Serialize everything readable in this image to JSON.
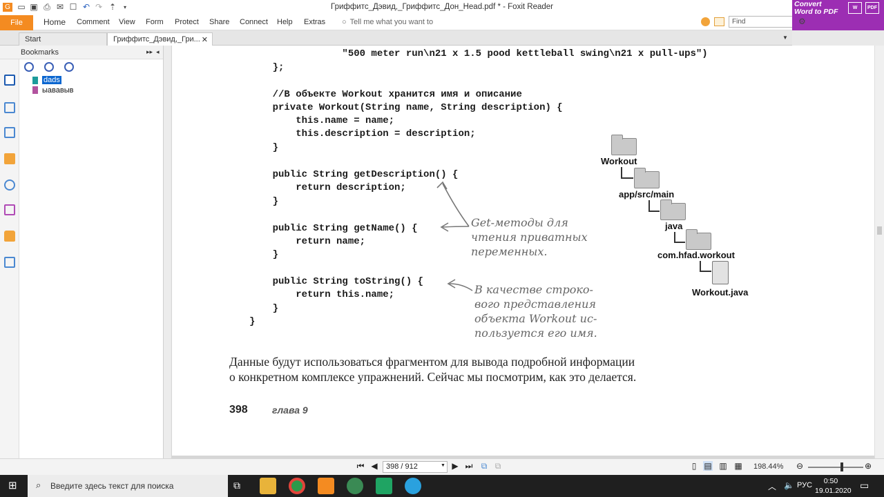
{
  "window": {
    "title": "Гриффитс_Дэвид,_Гриффитс_Дон_Head.pdf * - Foxit Reader"
  },
  "ribbon": {
    "file": "File",
    "menus": [
      "Home",
      "Comment",
      "View",
      "Form",
      "Protect",
      "Share",
      "Connect",
      "Help",
      "Extras"
    ],
    "tell_me": "Tell me what you want to",
    "find_placeholder": "Find",
    "convert_line1": "Convert",
    "convert_line2": "Word to PDF"
  },
  "tabs": [
    {
      "label": "Start"
    },
    {
      "label": "Гриффитс_Дэвид,_Гри..."
    }
  ],
  "bookmarks": {
    "header": "Bookmarks",
    "items": [
      "dads",
      "ыававыв"
    ]
  },
  "document": {
    "code_lines": [
      "                \"500 meter run\\n21 x 1.5 pood kettleball swing\\n21 x pull-ups\")",
      "    };",
      "",
      "    //В объекте Workout хранится имя и описание",
      "    private Workout(String name, String description) {",
      "        this.name = name;",
      "        this.description = description;",
      "    }",
      "",
      "    public String getDescription() {",
      "        return description;",
      "    }",
      "",
      "    public String getName() {",
      "        return name;",
      "    }",
      "",
      "    public String toString() {",
      "        return this.name;",
      "    }",
      "}"
    ],
    "note1": "Get-методы для\nчтения приватных\nпеременных.",
    "note2": "В качестве строко-\nвого представления\nобъекта Workout ис-\nпользуется его имя.",
    "tree": {
      "root": "Workout",
      "level1": "app/src/main",
      "level2": "java",
      "level3": "com.hfad.workout",
      "file": "Workout.java"
    },
    "body_line1": "Данные будут использоваться фрагментом для вывода подробной информации",
    "body_line2": "о конкретном комплексе упражнений. Сейчас мы посмотрим, как это делается.",
    "page_number": "398",
    "chapter": "глава 9"
  },
  "status": {
    "page_field": "398 / 912",
    "zoom": "198.44%"
  },
  "taskbar": {
    "search_placeholder": "Введите здесь текст для поиска",
    "lang": "РУС",
    "time": "0:50",
    "date": "19.01.2020"
  }
}
